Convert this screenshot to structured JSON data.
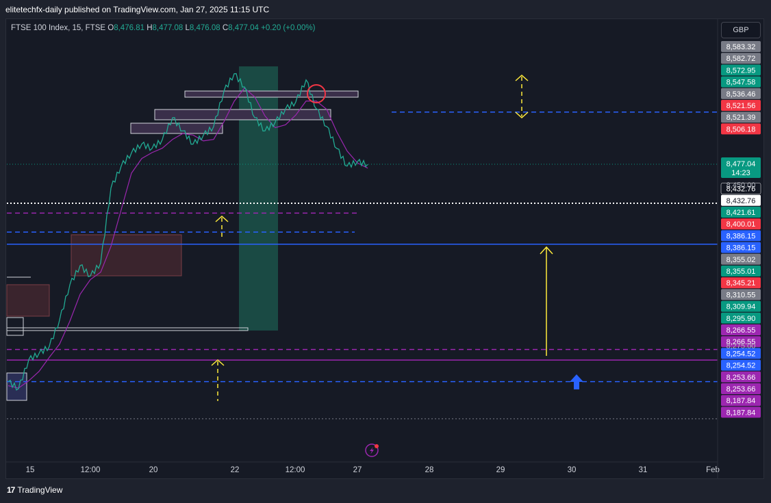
{
  "header": {
    "publisher": "elitetechfx-daily published on TradingView.com, Jan 27, 2025 11:15 UTC"
  },
  "legend": {
    "symbol": "FTSE 100 Index, 15, FTSE",
    "open_label": "O",
    "open": "8,476.81",
    "high_label": "H",
    "high": "8,477.08",
    "low_label": "L",
    "low": "8,476.08",
    "close_label": "C",
    "close": "8,477.04",
    "change": "+0.20 (+0.00%)"
  },
  "currency": "GBP",
  "footer": {
    "brand": "TradingView",
    "logo": "17"
  },
  "colors": {
    "bull": "#22ab94",
    "bear": "#f23645",
    "blue": "#2962ff",
    "purple": "#9c27b0",
    "yellow": "#ffeb3b",
    "white": "#ffffff",
    "gray": "#787b86",
    "green_zone": "#1e6b5a"
  },
  "chart_data": {
    "type": "line",
    "title": "FTSE 100 Index, 15, FTSE",
    "y_range": [
      8160,
      8600
    ],
    "x_tick_labels": [
      "15",
      "12:00",
      "20",
      "22",
      "12:00",
      "27",
      "28",
      "29",
      "30",
      "31",
      "Feb"
    ],
    "price_axis_ticks": [
      "8,450.00",
      "8,275.00"
    ],
    "last_price": {
      "value": "8,477.04",
      "countdown": "14:23"
    },
    "price_tags": [
      {
        "value": "8,583.32",
        "color": "gray"
      },
      {
        "value": "8,582.72",
        "color": "gray"
      },
      {
        "value": "8,572.95",
        "color": "bull"
      },
      {
        "value": "8,547.58",
        "color": "bull"
      },
      {
        "value": "8,536.46",
        "color": "gray"
      },
      {
        "value": "8,521.56",
        "color": "bear"
      },
      {
        "value": "8,521.39",
        "color": "gray"
      },
      {
        "value": "8,506.18",
        "color": "bear"
      },
      {
        "value": "8,432.76",
        "color": "black"
      },
      {
        "value": "8,432.76",
        "color": "white"
      },
      {
        "value": "8,421.61",
        "color": "bull"
      },
      {
        "value": "8,400.01",
        "color": "bear"
      },
      {
        "value": "8,386.15",
        "color": "blue"
      },
      {
        "value": "8,386.15",
        "color": "blue"
      },
      {
        "value": "8,355.02",
        "color": "gray"
      },
      {
        "value": "8,355.01",
        "color": "bull"
      },
      {
        "value": "8,345.21",
        "color": "bear"
      },
      {
        "value": "8,310.55",
        "color": "gray"
      },
      {
        "value": "8,309.94",
        "color": "bull"
      },
      {
        "value": "8,295.90",
        "color": "bull"
      },
      {
        "value": "8,266.55",
        "color": "purple"
      },
      {
        "value": "8,266.55",
        "color": "purple"
      },
      {
        "value": "8,254.52",
        "color": "blue"
      },
      {
        "value": "8,254.52",
        "color": "blue"
      },
      {
        "value": "8,253.66",
        "color": "purple"
      },
      {
        "value": "8,253.66",
        "color": "purple"
      },
      {
        "value": "8,187.84",
        "color": "purple"
      },
      {
        "value": "8,187.84",
        "color": "purple"
      }
    ],
    "horizontal_levels": [
      {
        "price": 8536.46,
        "style": "dashed",
        "color": "blue"
      },
      {
        "price": 8432.76,
        "style": "dotted",
        "color": "white"
      },
      {
        "price": 8421.61,
        "style": "dashed",
        "color": "purple"
      },
      {
        "price": 8400.01,
        "style": "dashed",
        "color": "blue"
      },
      {
        "price": 8386.15,
        "style": "solid",
        "color": "blue"
      },
      {
        "price": 8266.55,
        "style": "dashed",
        "color": "purple"
      },
      {
        "price": 8254.52,
        "style": "solid",
        "color": "purple"
      },
      {
        "price": 8230.0,
        "style": "dashed",
        "color": "blue"
      },
      {
        "price": 8187.84,
        "style": "dotted",
        "color": "gray"
      }
    ],
    "price_path": [
      [
        0,
        8230
      ],
      [
        1,
        8222
      ],
      [
        2,
        8255
      ],
      [
        3,
        8262
      ],
      [
        4,
        8270
      ],
      [
        5,
        8300
      ],
      [
        6,
        8340
      ],
      [
        7,
        8362
      ],
      [
        8,
        8350
      ],
      [
        9,
        8365
      ],
      [
        10,
        8450
      ],
      [
        11,
        8475
      ],
      [
        12,
        8490
      ],
      [
        13,
        8500
      ],
      [
        14,
        8495
      ],
      [
        15,
        8505
      ],
      [
        16,
        8530
      ],
      [
        17,
        8515
      ],
      [
        18,
        8500
      ],
      [
        19,
        8510
      ],
      [
        20,
        8520
      ],
      [
        21,
        8560
      ],
      [
        22,
        8580
      ],
      [
        23,
        8565
      ],
      [
        24,
        8530
      ],
      [
        25,
        8515
      ],
      [
        26,
        8525
      ],
      [
        27,
        8540
      ],
      [
        28,
        8548
      ],
      [
        29,
        8573
      ],
      [
        30,
        8540
      ],
      [
        31,
        8520
      ],
      [
        32,
        8495
      ],
      [
        33,
        8475
      ],
      [
        34,
        8480
      ],
      [
        35,
        8477
      ]
    ]
  }
}
